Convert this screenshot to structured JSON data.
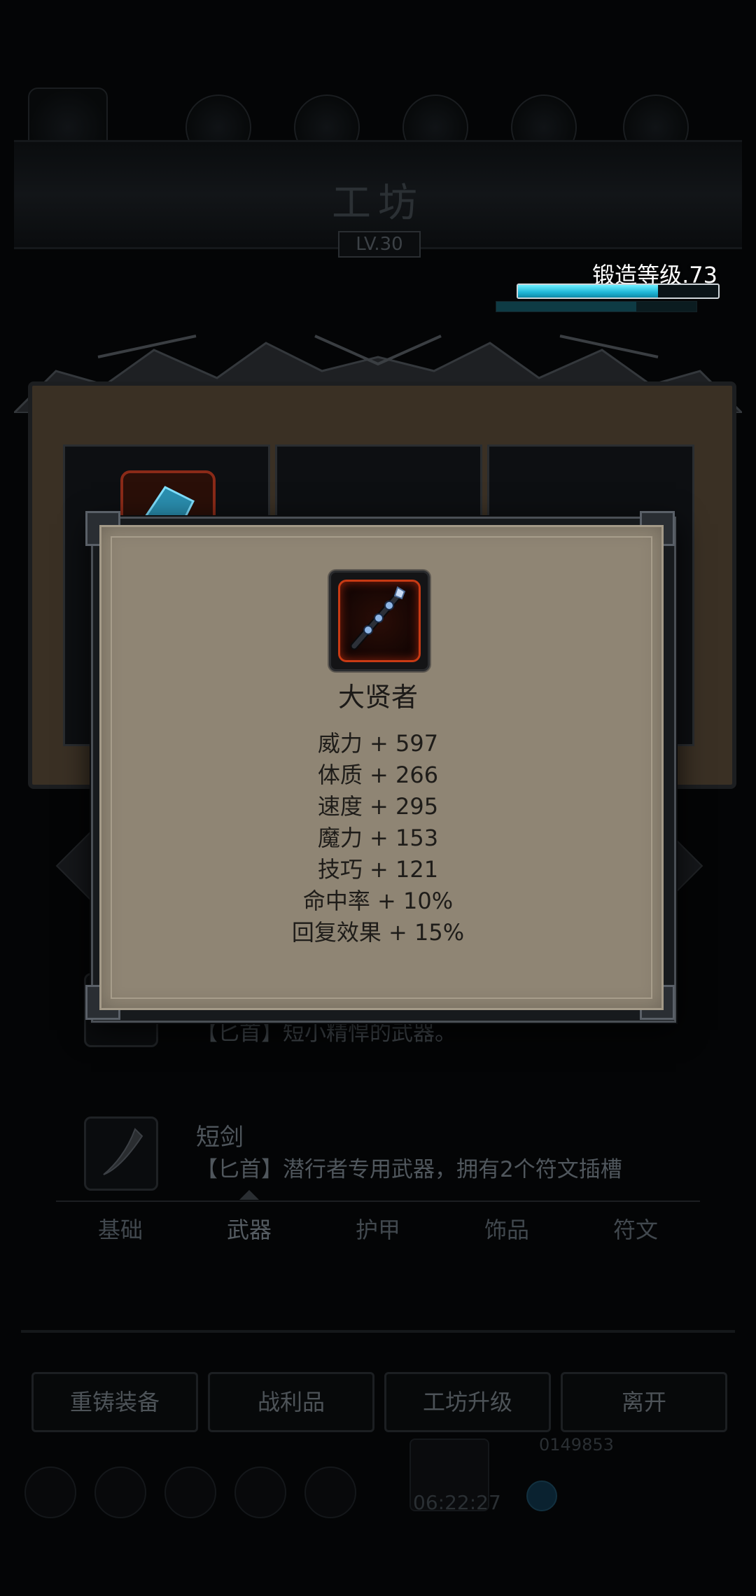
{
  "workshop": {
    "title": "工坊",
    "level": "LV.30",
    "forge_level_label": "锻造等级.73",
    "forge_progress": 0.7,
    "forge_sub_progress": 0.7
  },
  "item_list": [
    {
      "name": "",
      "description": "【匕首】短小精悍的武器。"
    },
    {
      "name": "短剑",
      "description": "【匕首】潜行者专用武器，拥有2个符文插槽"
    }
  ],
  "tabs": [
    {
      "label": "基础"
    },
    {
      "label": "武器"
    },
    {
      "label": "护甲"
    },
    {
      "label": "饰品"
    },
    {
      "label": "符文"
    }
  ],
  "actions": [
    {
      "label": "重铸装备"
    },
    {
      "label": "战利品"
    },
    {
      "label": "工坊升级"
    },
    {
      "label": "离开"
    }
  ],
  "status": {
    "timer": "06:22:27",
    "gold": "0149853"
  },
  "popup": {
    "item_name": "大贤者",
    "icon": "staff-icon",
    "stats": [
      "威力 + 597",
      "体质 + 266",
      "速度 + 295",
      "魔力 + 153",
      "技巧 + 121",
      "命中率 + 10%",
      "回复效果 + 15%"
    ]
  },
  "colors": {
    "popup_parchment": "#8f8574",
    "forge_bar": "#1fb6d6",
    "icon_frame_red": "#c83a14"
  }
}
